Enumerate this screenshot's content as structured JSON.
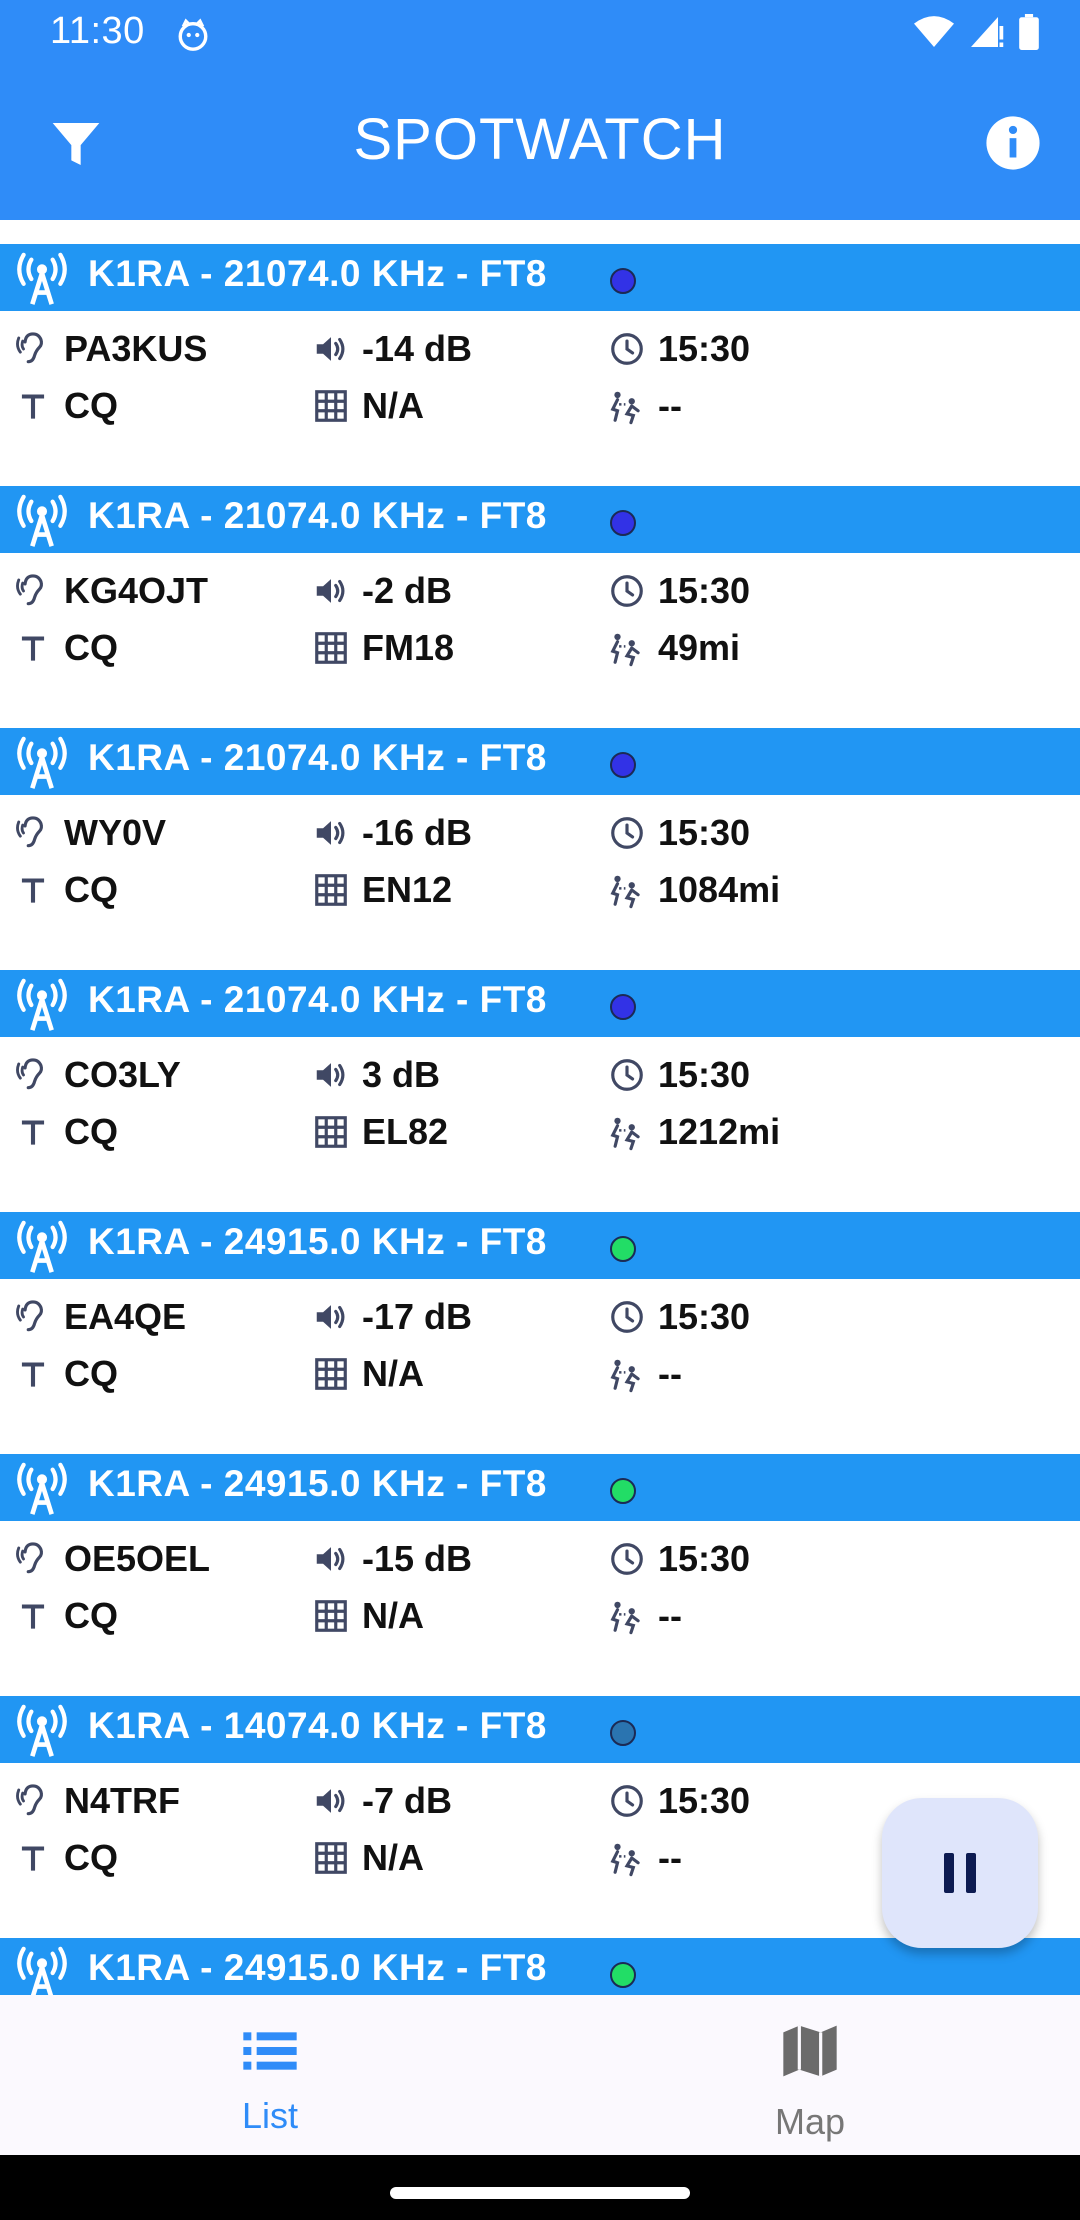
{
  "status_bar": {
    "time": "11:30"
  },
  "app_bar": {
    "title": "SPOTWATCH"
  },
  "colors": {
    "primary": "#2f8cf8",
    "header": "#2196f3",
    "dot_blue": "#3232e6",
    "dot_green": "#22dd66",
    "dot_teal": "#2a74b0"
  },
  "spots": [
    {
      "title": "K1RA - 21074.0 KHz - FT8",
      "dot": "blue",
      "callsign": "PA3KUS",
      "snr": "-14 dB",
      "time": "15:30",
      "message": "CQ",
      "grid": "N/A",
      "distance": "--"
    },
    {
      "title": "K1RA - 21074.0 KHz - FT8",
      "dot": "blue",
      "callsign": "KG4OJT",
      "snr": "-2 dB",
      "time": "15:30",
      "message": "CQ",
      "grid": "FM18",
      "distance": "49mi"
    },
    {
      "title": "K1RA - 21074.0 KHz - FT8",
      "dot": "blue",
      "callsign": "WY0V",
      "snr": "-16 dB",
      "time": "15:30",
      "message": "CQ",
      "grid": "EN12",
      "distance": "1084mi"
    },
    {
      "title": "K1RA - 21074.0 KHz - FT8",
      "dot": "blue",
      "callsign": "CO3LY",
      "snr": "3 dB",
      "time": "15:30",
      "message": "CQ",
      "grid": "EL82",
      "distance": "1212mi"
    },
    {
      "title": "K1RA - 24915.0 KHz - FT8",
      "dot": "green",
      "callsign": "EA4QE",
      "snr": "-17 dB",
      "time": "15:30",
      "message": "CQ",
      "grid": "N/A",
      "distance": "--"
    },
    {
      "title": "K1RA - 24915.0 KHz - FT8",
      "dot": "green",
      "callsign": "OE5OEL",
      "snr": "-15 dB",
      "time": "15:30",
      "message": "CQ",
      "grid": "N/A",
      "distance": "--"
    },
    {
      "title": "K1RA - 14074.0 KHz - FT8",
      "dot": "teal",
      "callsign": "N4TRF",
      "snr": "-7 dB",
      "time": "15:30",
      "message": "CQ",
      "grid": "N/A",
      "distance": "--"
    },
    {
      "title": "K1RA - 24915.0 KHz - FT8",
      "dot": "green"
    }
  ],
  "fab": {
    "icon": "pause-icon"
  },
  "bottom_nav": {
    "list_label": "List",
    "map_label": "Map"
  }
}
